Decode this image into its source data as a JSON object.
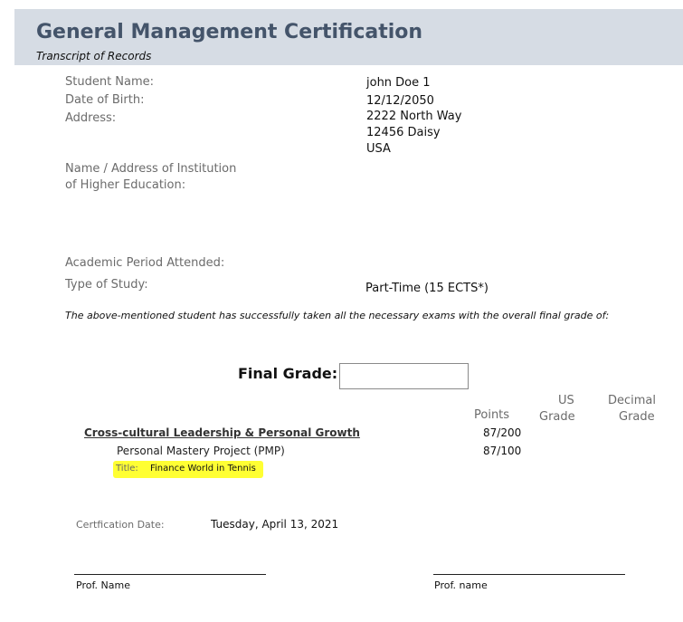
{
  "header": {
    "title": "General Management Certification",
    "subtitle": "Transcript of Records"
  },
  "student": {
    "name_label": "Student Name:",
    "name_value": "john Doe 1",
    "dob_label": "Date of Birth:",
    "dob_value": "12/12/2050",
    "address_label": "Address:",
    "address_lines": [
      "2222 North Way",
      "12456 Daisy",
      "USA"
    ]
  },
  "institution": {
    "label_line1": "Name / Address of Institution",
    "label_line2": "of Higher Education:"
  },
  "study": {
    "period_label": "Academic Period Attended:",
    "type_label": "Type of Study:",
    "type_value": "Part-Time (15 ECTS*)"
  },
  "statement": "The above-mentioned student has successfully taken all the necessary exams  with the overall final grade of:",
  "final_grade": {
    "label": "Final Grade:",
    "value": ""
  },
  "columns": {
    "points": "Points",
    "us_grade_line1": "US",
    "us_grade_line2": "Grade",
    "decimal_grade_line1": "Decimal",
    "decimal_grade_line2": "Grade"
  },
  "module": {
    "name": "Cross-cultural Leadership & Personal Growth",
    "points": "87/200",
    "project_name": "Personal Mastery Project (PMP)",
    "project_points": "87/100",
    "title_label": "Title:",
    "title_value": "Finance World in Tennis",
    "highlight_color": "#ffff33"
  },
  "certification": {
    "date_label": "Certfication Date:",
    "date_value": "Tuesday, April 13, 2021"
  },
  "signatures": {
    "left_label": "Prof. Name",
    "right_label": "Prof. name"
  }
}
